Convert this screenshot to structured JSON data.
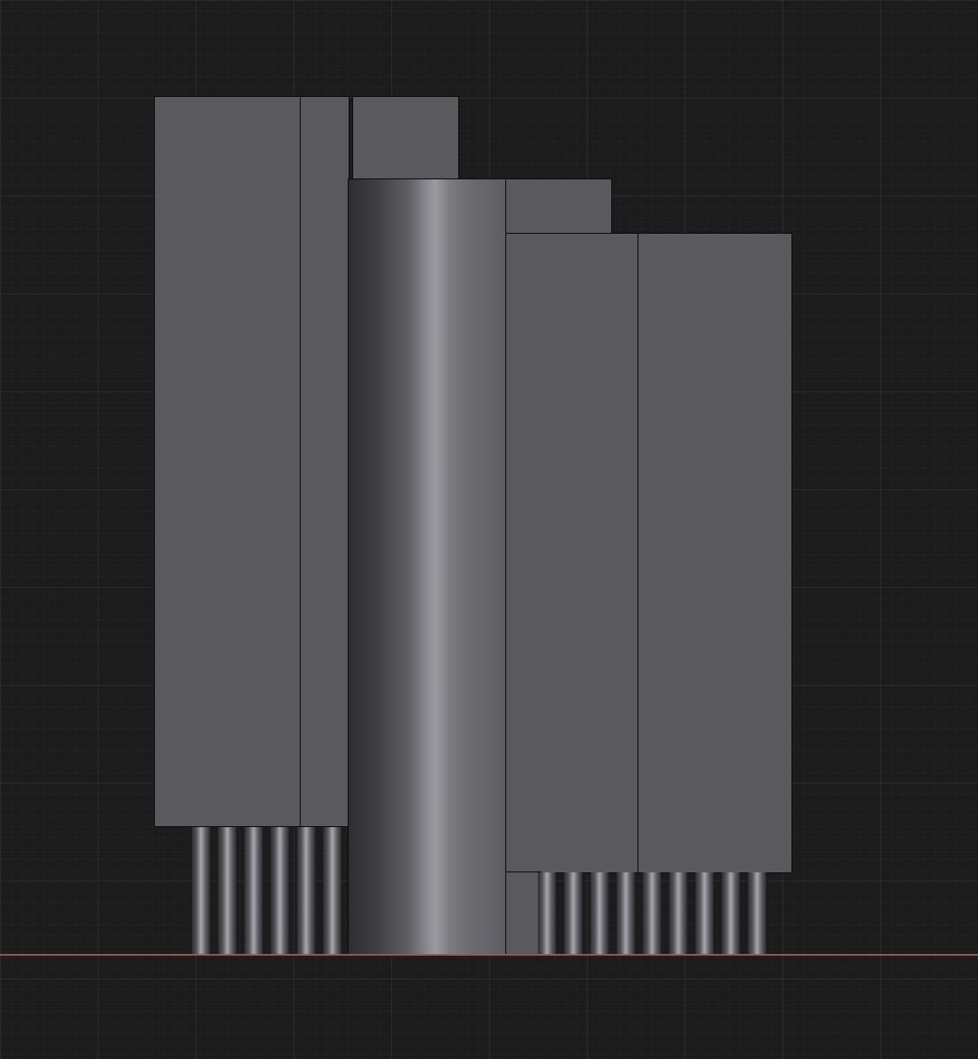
{
  "viewport": {
    "background": "#1c1c1d",
    "grid": true,
    "grid_color": "#2a2a2c",
    "ground_line_color": "#a05a5a"
  },
  "scene": {
    "slab_color": "#5a595e",
    "outline_color": "#0b0b0c",
    "column_highlight": "#9b9ba1",
    "left_pipe_count": 6,
    "right_pipe_count": 9
  }
}
